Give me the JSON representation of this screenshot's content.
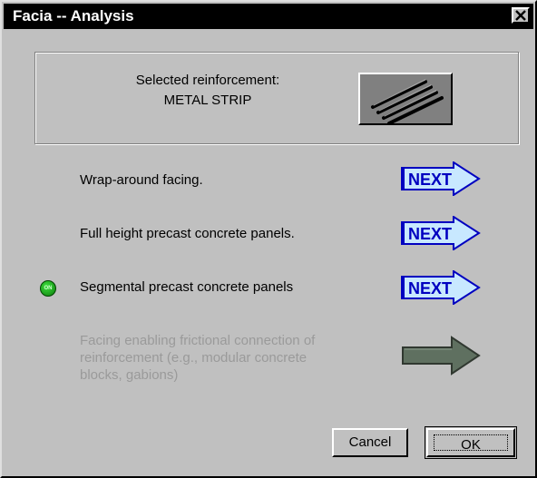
{
  "window": {
    "title": "Facia -- Analysis"
  },
  "selection": {
    "label": "Selected reinforcement:",
    "value": "METAL STRIP"
  },
  "options": [
    {
      "label": "Wrap-around  facing.",
      "button": "NEXT",
      "selected": false,
      "enabled": true
    },
    {
      "label": "Full height precast concrete panels.",
      "button": "NEXT",
      "selected": false,
      "enabled": true
    },
    {
      "label": "Segmental  precast concrete panels",
      "button": "NEXT",
      "selected": true,
      "enabled": true
    },
    {
      "label": [
        "Facing enabling frictional connection of",
        "reinforcement  (e.g., modular concrete",
        "blocks, gabions)"
      ],
      "selected": false,
      "enabled": false
    }
  ],
  "indicator": {
    "text": "ON",
    "color": "#10a010"
  },
  "buttons": {
    "cancel": "Cancel",
    "ok": "OK"
  },
  "colors": {
    "next_text": "#0000c0",
    "next_bg": "#c8e8ff",
    "disabled_text": "#9a9a9a",
    "disabled_arrow": "#5f7060"
  }
}
